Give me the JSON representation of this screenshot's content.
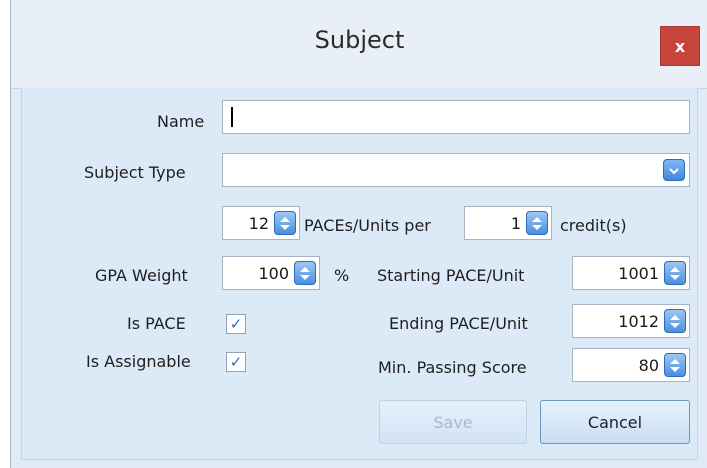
{
  "dialog": {
    "title": "Subject",
    "close_label": "x"
  },
  "form": {
    "name": {
      "label": "Name",
      "value": ""
    },
    "subject_type": {
      "label": "Subject Type",
      "value": ""
    },
    "paces": {
      "count": "12",
      "text_mid": "PACEs/Units per",
      "credits": "1",
      "text_end": "credit(s)"
    },
    "gpa_weight": {
      "label": "GPA Weight",
      "value": "100",
      "unit": "%"
    },
    "starting_pace": {
      "label": "Starting PACE/Unit",
      "value": "1001"
    },
    "is_pace": {
      "label": "Is PACE",
      "checked": true
    },
    "ending_pace": {
      "label": "Ending PACE/Unit",
      "value": "1012"
    },
    "is_assignable": {
      "label": "Is Assignable",
      "checked": true
    },
    "min_passing": {
      "label": "Min. Passing Score",
      "value": "80"
    }
  },
  "buttons": {
    "save_label": "Save",
    "cancel_label": "Cancel"
  },
  "icons": {
    "checkmark": "✓",
    "spin": "spin-updown-icon",
    "dropdown": "chevron-down-icon"
  },
  "colors": {
    "close": "#c7443a",
    "accent": "#3f86dc",
    "dialog_bg": "#dce9f6"
  }
}
